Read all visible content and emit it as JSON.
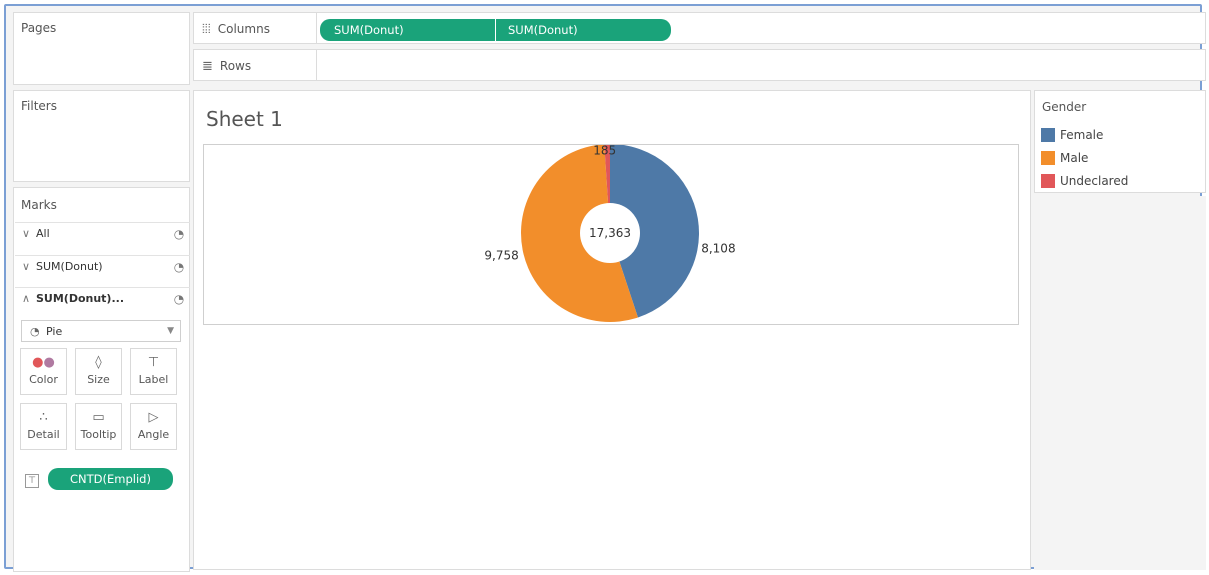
{
  "panels": {
    "pages_title": "Pages",
    "filters_title": "Filters",
    "marks_title": "Marks"
  },
  "shelves": {
    "columns_label": "Columns",
    "rows_label": "Rows",
    "columns_pills": [
      "SUM(Donut)",
      "SUM(Donut)"
    ]
  },
  "marks": {
    "rows": [
      {
        "chevron": "∨",
        "label": "All",
        "bold": false
      },
      {
        "chevron": "∨",
        "label": "SUM(Donut)",
        "bold": false
      },
      {
        "chevron": "∧",
        "label": "SUM(Donut)...",
        "bold": true
      }
    ],
    "mark_type": "Pie",
    "buttons": [
      "Color",
      "Size",
      "Label",
      "Detail",
      "Tooltip",
      "Angle"
    ],
    "field_pill": "CNTD(Emplid)"
  },
  "sheet": {
    "title": "Sheet 1"
  },
  "legend": {
    "title": "Gender",
    "items": [
      {
        "label": "Female",
        "color": "#4e79a7"
      },
      {
        "label": "Male",
        "color": "#f28e2b"
      },
      {
        "label": "Undeclared",
        "color": "#e15759"
      }
    ]
  },
  "chart_data": {
    "type": "pie",
    "categories": [
      "Female",
      "Male",
      "Undeclared"
    ],
    "values": [
      8108,
      9758,
      185
    ],
    "data_labels": [
      "8,108",
      "9,758",
      "185"
    ],
    "colors": [
      "#4e79a7",
      "#f28e2b",
      "#e15759"
    ],
    "center_label": "17,363"
  }
}
